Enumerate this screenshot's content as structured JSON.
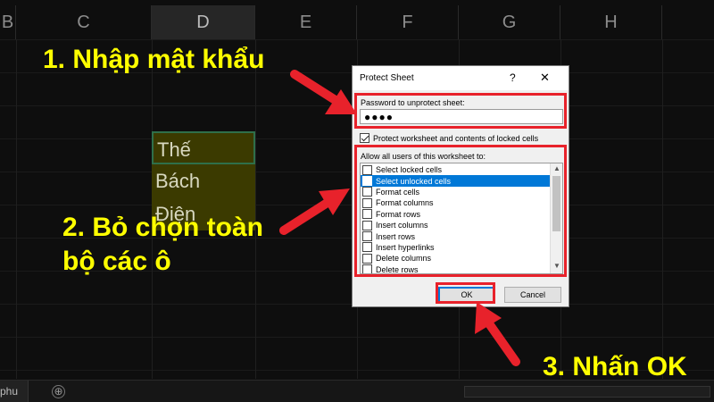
{
  "sheet": {
    "columns": [
      "B",
      "C",
      "D",
      "E",
      "F",
      "G",
      "H"
    ],
    "selected_column": "D",
    "cells": [
      "Thế",
      "Bách",
      "Điện"
    ],
    "tab_label": "phu",
    "add_sheet_symbol": "⊕"
  },
  "annotations": {
    "step1": "1. Nhập mật khẩu",
    "step2_line1": "2. Bỏ chọn toàn",
    "step2_line2": "bộ các ô",
    "step3": "3. Nhấn OK",
    "color": "#ffff00",
    "arrow_color": "#e8222b"
  },
  "dialog": {
    "title": "Protect Sheet",
    "help_symbol": "?",
    "close_symbol": "✕",
    "password_label": "Password to unprotect sheet:",
    "password_value": "●●●●",
    "protect_label": "Protect worksheet and contents of locked cells",
    "protect_checked": true,
    "allow_label": "Allow all users of this worksheet to:",
    "permissions": [
      {
        "label": "Select locked cells",
        "checked": false,
        "selected": false
      },
      {
        "label": "Select unlocked cells",
        "checked": false,
        "selected": true
      },
      {
        "label": "Format cells",
        "checked": false,
        "selected": false
      },
      {
        "label": "Format columns",
        "checked": false,
        "selected": false
      },
      {
        "label": "Format rows",
        "checked": false,
        "selected": false
      },
      {
        "label": "Insert columns",
        "checked": false,
        "selected": false
      },
      {
        "label": "Insert rows",
        "checked": false,
        "selected": false
      },
      {
        "label": "Insert hyperlinks",
        "checked": false,
        "selected": false
      },
      {
        "label": "Delete columns",
        "checked": false,
        "selected": false
      },
      {
        "label": "Delete rows",
        "checked": false,
        "selected": false
      }
    ],
    "ok_label": "OK",
    "cancel_label": "Cancel"
  }
}
